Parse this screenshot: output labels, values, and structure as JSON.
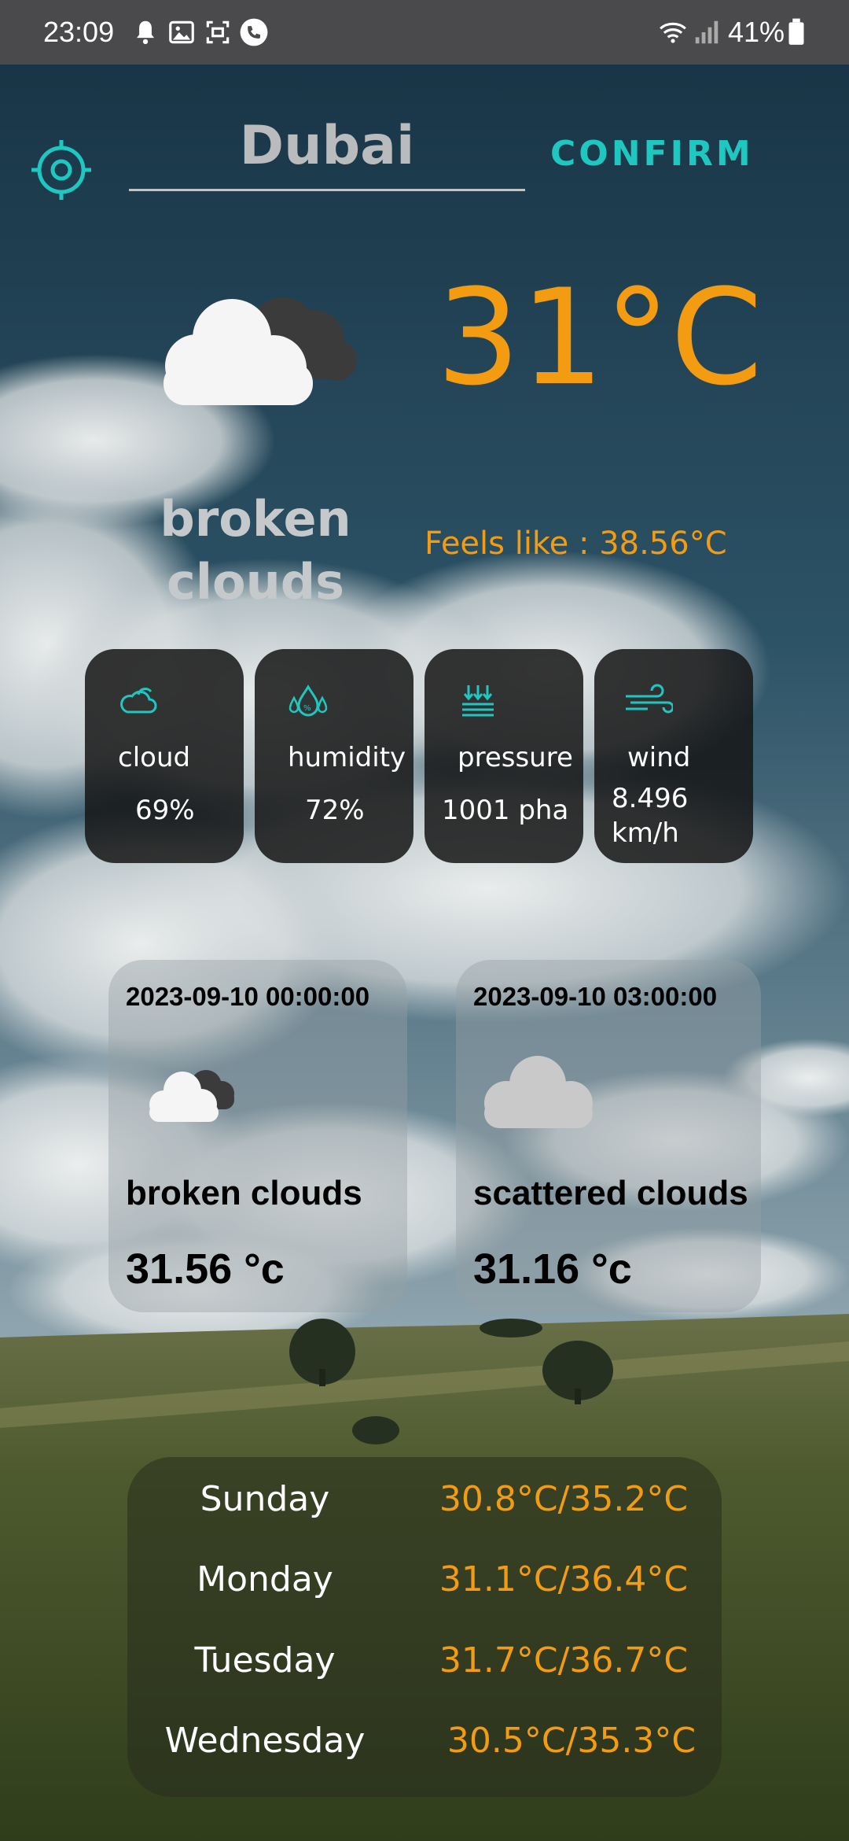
{
  "status_bar": {
    "time": "23:09",
    "icons": [
      "alarm-bell-icon",
      "gallery-icon",
      "screenshot-icon",
      "phone-call-icon",
      "wifi-icon",
      "signal-icon",
      "battery-icon"
    ],
    "battery_percent": "41%"
  },
  "header": {
    "city": "Dubai",
    "confirm_label": "CONFIRM",
    "locate_icon": "crosshair-locate-icon",
    "accent_color": "#1ec8c0"
  },
  "current": {
    "temperature": "31°C",
    "description": "broken clouds",
    "feels_like": "Feels like : 38.56°C",
    "icon": "broken-clouds-icon",
    "temp_color": "#f39c12"
  },
  "stats": [
    {
      "icon": "cloud-icon",
      "label": "cloud",
      "value": "69%"
    },
    {
      "icon": "humidity-icon",
      "label": "humidity",
      "value": "72%"
    },
    {
      "icon": "pressure-icon",
      "label": "pressure",
      "value": "1001 pha"
    },
    {
      "icon": "wind-icon",
      "label": "wind",
      "value": "8.496 km/h"
    }
  ],
  "forecast": [
    {
      "datetime": "2023-09-10 00:00:00",
      "icon": "broken-clouds-icon",
      "description": "broken clouds",
      "temp": "31.56 °c"
    },
    {
      "datetime": "2023-09-10 03:00:00",
      "icon": "scattered-clouds-icon",
      "description": "scattered clouds",
      "temp": "31.16 °c"
    }
  ],
  "daily": [
    {
      "day": "Sunday",
      "range": "30.8°C/35.2°C"
    },
    {
      "day": "Monday",
      "range": "31.1°C/36.4°C"
    },
    {
      "day": "Tuesday",
      "range": "31.7°C/36.7°C"
    },
    {
      "day": "Wednesday",
      "range": "30.5°C/35.3°C"
    }
  ]
}
